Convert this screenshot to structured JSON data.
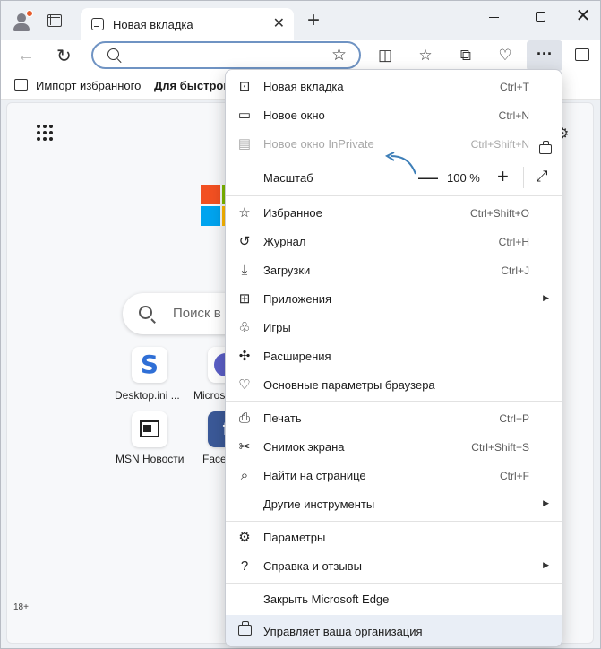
{
  "tab": {
    "title": "Новая вкладка",
    "close": "✕"
  },
  "new_tab_button": "+",
  "window_controls": {
    "close": "✕"
  },
  "bookmarks_bar": {
    "import_label": "Импорт избранного",
    "quick_access_label": "Для быстрого"
  },
  "page": {
    "search_placeholder": "Поиск в",
    "tiles": [
      {
        "label": "Desktop.ini ...",
        "letter": "S"
      },
      {
        "label": "Micros"
      },
      {
        "label": "MSN Новости"
      },
      {
        "label": "Facel",
        "letter": "f"
      }
    ],
    "age_badge": "18+"
  },
  "menu": {
    "new_tab": {
      "label": "Новая вкладка",
      "shortcut": "Ctrl+T"
    },
    "new_window": {
      "label": "Новое окно",
      "shortcut": "Ctrl+N"
    },
    "new_inprivate": {
      "label": "Новое окно InPrivate",
      "shortcut": "Ctrl+Shift+N"
    },
    "zoom": {
      "label": "Масштаб",
      "value": "100 %",
      "minus": "—",
      "plus": "+"
    },
    "favorites": {
      "label": "Избранное",
      "shortcut": "Ctrl+Shift+O"
    },
    "history": {
      "label": "Журнал",
      "shortcut": "Ctrl+H"
    },
    "downloads": {
      "label": "Загрузки",
      "shortcut": "Ctrl+J"
    },
    "apps": {
      "label": "Приложения"
    },
    "games": {
      "label": "Игры"
    },
    "extensions": {
      "label": "Расширения"
    },
    "essentials": {
      "label": "Основные параметры браузера"
    },
    "print": {
      "label": "Печать",
      "shortcut": "Ctrl+P"
    },
    "screenshot": {
      "label": "Снимок экрана",
      "shortcut": "Ctrl+Shift+S"
    },
    "find": {
      "label": "Найти на странице",
      "shortcut": "Ctrl+F"
    },
    "more_tools": {
      "label": "Другие инструменты"
    },
    "settings": {
      "label": "Параметры"
    },
    "help": {
      "label": "Справка и отзывы"
    },
    "close_edge": {
      "label": "Закрыть Microsoft Edge"
    },
    "managed": {
      "label": "Управляет ваша организация"
    }
  },
  "colors": {
    "accent": "#6f93c3",
    "menu_bg": "#ffffff",
    "managed_bg": "#e9eef6"
  }
}
